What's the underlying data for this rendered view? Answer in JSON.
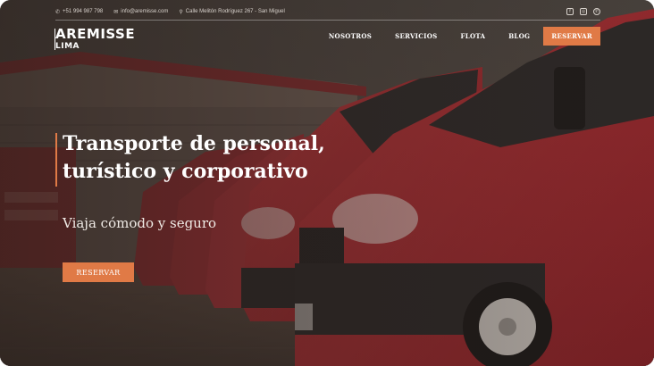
{
  "topbar": {
    "phone": "+51 994 987 798",
    "email": "info@aremisse.com",
    "address": "Calle Melitón Rodríguez 267 - San Miguel",
    "socials": [
      "facebook-icon",
      "instagram-icon",
      "whatsapp-icon"
    ]
  },
  "header": {
    "logo_name": "AREMISSE",
    "logo_city": "LIMA",
    "nav": [
      "NOSOTROS",
      "SERVICIOS",
      "FLOTA",
      "BLOG"
    ],
    "cta": "RESERVAR"
  },
  "hero": {
    "title_line1": "Transporte de personal,",
    "title_line2": "turístico y corporativo",
    "subtitle": "Viaja cómodo y seguro",
    "button": "RESERVAR"
  },
  "colors": {
    "accent": "#e07a46",
    "van_red": "#9c2a2e",
    "text": "#ffffff"
  }
}
